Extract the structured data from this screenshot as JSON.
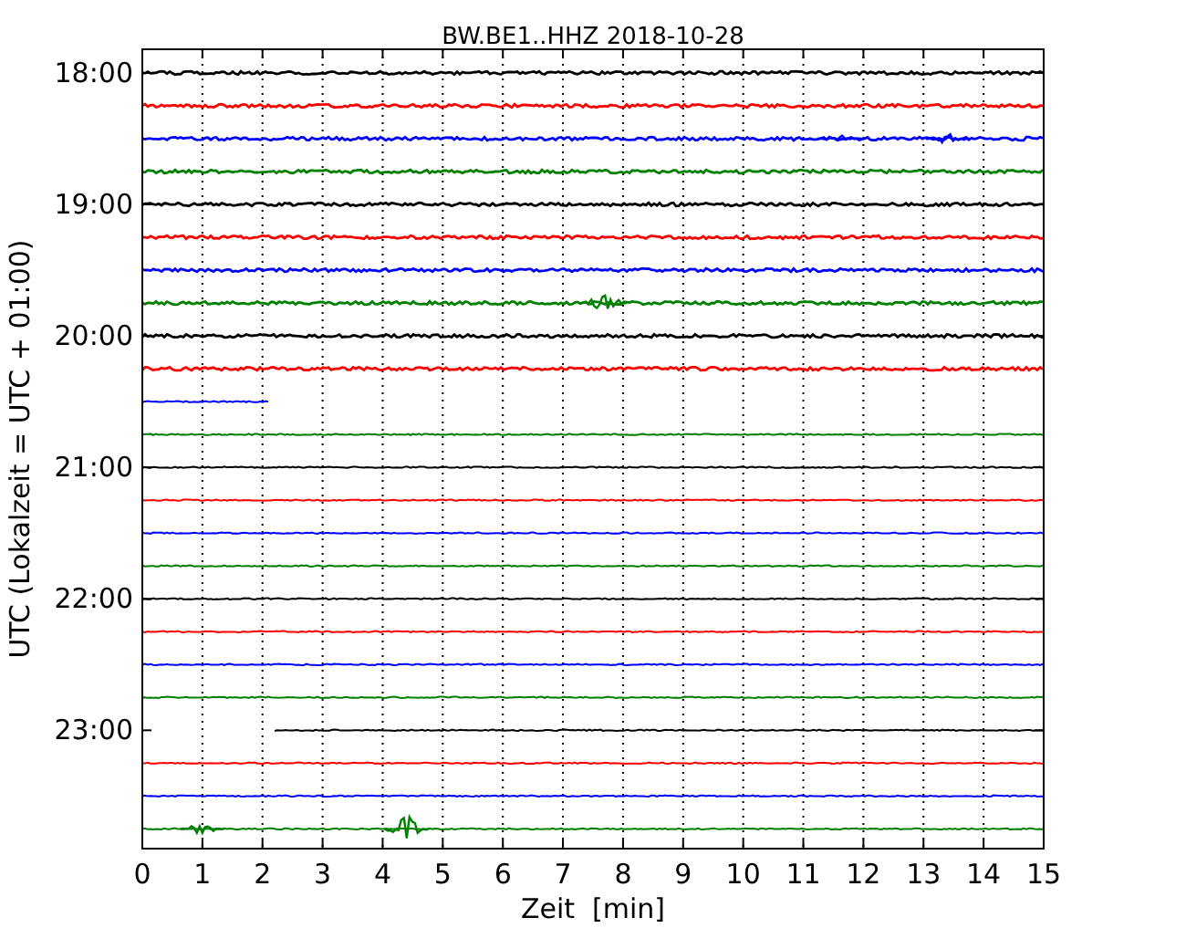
{
  "chart": {
    "chart_data": {
      "type": "line",
      "title": "BW.BE1..HHZ 2018-10-28",
      "xlabel": "Zeit  [min]",
      "ylabel": "UTC (Lokalzeit = UTC + 01:00)",
      "xlim": [
        0,
        15
      ],
      "ylim": [
        23.9,
        17.82
      ],
      "grid": "x",
      "xticks": [
        0,
        1,
        2,
        3,
        4,
        5,
        6,
        7,
        8,
        9,
        10,
        11,
        12,
        13,
        14,
        15
      ],
      "yticks": [
        {
          "value": 18,
          "label": "18:00"
        },
        {
          "value": 19,
          "label": "19:00"
        },
        {
          "value": 20,
          "label": "20:00"
        },
        {
          "value": 21,
          "label": "21:00"
        },
        {
          "value": 22,
          "label": "22:00"
        },
        {
          "value": 23,
          "label": "23:00"
        }
      ],
      "x": [
        0,
        1,
        2,
        2.1,
        2.2,
        3,
        4,
        5,
        6,
        7,
        8,
        9,
        10,
        11,
        12,
        13,
        14,
        15
      ],
      "series": [
        {
          "color": "#000000",
          "values": [
            18,
            18,
            18,
            18,
            18,
            18,
            18,
            18,
            18,
            18,
            18,
            18,
            18,
            18,
            18,
            18,
            18,
            18
          ]
        },
        {
          "color": "#ff0000",
          "values": [
            18.25,
            18.25,
            18.25,
            18.25,
            18.25,
            18.25,
            18.25,
            18.25,
            18.25,
            18.25,
            18.25,
            18.25,
            18.25,
            18.25,
            18.25,
            18.25,
            18.25,
            18.25
          ]
        },
        {
          "color": "#0000ff",
          "values": [
            18.5,
            18.5,
            18.5,
            18.5,
            18.5,
            18.5,
            18.5,
            18.5,
            18.5,
            18.5,
            18.5,
            18.5,
            18.5,
            18.5,
            18.5,
            18.5,
            18.5,
            18.5
          ]
        },
        {
          "color": "#008000",
          "values": [
            18.75,
            18.75,
            18.75,
            18.75,
            18.75,
            18.75,
            18.75,
            18.75,
            18.75,
            18.75,
            18.75,
            18.75,
            18.75,
            18.75,
            18.75,
            18.75,
            18.75,
            18.75
          ]
        },
        {
          "color": "#000000",
          "values": [
            19,
            19,
            19,
            19,
            19,
            19,
            19,
            19,
            19,
            19,
            19,
            19,
            19,
            19,
            19,
            19,
            19,
            19
          ]
        },
        {
          "color": "#ff0000",
          "values": [
            19.25,
            19.25,
            19.25,
            19.25,
            19.25,
            19.25,
            19.25,
            19.25,
            19.25,
            19.25,
            19.25,
            19.25,
            19.25,
            19.25,
            19.25,
            19.25,
            19.25,
            19.25
          ]
        },
        {
          "color": "#0000ff",
          "values": [
            19.5,
            19.5,
            19.5,
            19.5,
            19.5,
            19.5,
            19.5,
            19.5,
            19.5,
            19.5,
            19.5,
            19.5,
            19.5,
            19.5,
            19.5,
            19.5,
            19.5,
            19.5
          ]
        },
        {
          "color": "#008000",
          "values": [
            19.75,
            19.75,
            19.75,
            19.75,
            19.75,
            19.75,
            19.75,
            19.75,
            19.75,
            19.75,
            19.75,
            19.75,
            19.75,
            19.75,
            19.75,
            19.75,
            19.75,
            19.75
          ]
        },
        {
          "color": "#000000",
          "values": [
            20,
            20,
            20,
            20,
            20,
            20,
            20,
            20,
            20,
            20,
            20,
            20,
            20,
            20,
            20,
            20,
            20,
            20
          ]
        },
        {
          "color": "#ff0000",
          "values": [
            20.25,
            20.25,
            20.25,
            20.25,
            20.25,
            20.25,
            20.25,
            20.25,
            20.25,
            20.25,
            20.25,
            20.25,
            20.25,
            20.25,
            20.25,
            20.25,
            20.25,
            20.25
          ]
        },
        {
          "color": "#0000ff",
          "values": [
            20.5,
            20.5,
            20.5,
            20.5,
            null,
            null,
            null,
            null,
            null,
            null,
            null,
            null,
            null,
            null,
            null,
            null,
            null,
            null
          ]
        },
        {
          "color": "#008000",
          "values": [
            20.75,
            20.75,
            20.75,
            20.75,
            20.75,
            20.75,
            20.75,
            20.75,
            20.75,
            20.75,
            20.75,
            20.75,
            20.75,
            20.75,
            20.75,
            20.75,
            20.75,
            20.75
          ]
        },
        {
          "color": "#000000",
          "values": [
            21,
            21,
            21,
            21,
            21,
            21,
            21,
            21,
            21,
            21,
            21,
            21,
            21,
            21,
            21,
            21,
            21,
            21
          ]
        },
        {
          "color": "#ff0000",
          "values": [
            21.25,
            21.25,
            21.25,
            21.25,
            21.25,
            21.25,
            21.25,
            21.25,
            21.25,
            21.25,
            21.25,
            21.25,
            21.25,
            21.25,
            21.25,
            21.25,
            21.25,
            21.25
          ]
        },
        {
          "color": "#0000ff",
          "values": [
            21.5,
            21.5,
            21.5,
            21.5,
            21.5,
            21.5,
            21.5,
            21.5,
            21.5,
            21.5,
            21.5,
            21.5,
            21.5,
            21.5,
            21.5,
            21.5,
            21.5,
            21.5
          ]
        },
        {
          "color": "#008000",
          "values": [
            21.75,
            21.75,
            21.75,
            21.75,
            21.75,
            21.75,
            21.75,
            21.75,
            21.75,
            21.75,
            21.75,
            21.75,
            21.75,
            21.75,
            21.75,
            21.75,
            21.75,
            21.75
          ]
        },
        {
          "color": "#000000",
          "values": [
            22,
            22,
            22,
            22,
            22,
            22,
            22,
            22,
            22,
            22,
            22,
            22,
            22,
            22,
            22,
            22,
            22,
            22
          ]
        },
        {
          "color": "#ff0000",
          "values": [
            22.25,
            22.25,
            22.25,
            22.25,
            22.25,
            22.25,
            22.25,
            22.25,
            22.25,
            22.25,
            22.25,
            22.25,
            22.25,
            22.25,
            22.25,
            22.25,
            22.25,
            22.25
          ]
        },
        {
          "color": "#0000ff",
          "values": [
            22.5,
            22.5,
            22.5,
            22.5,
            22.5,
            22.5,
            22.5,
            22.5,
            22.5,
            22.5,
            22.5,
            22.5,
            22.5,
            22.5,
            22.5,
            22.5,
            22.5,
            22.5
          ]
        },
        {
          "color": "#008000",
          "values": [
            22.75,
            22.75,
            22.75,
            22.75,
            22.75,
            22.75,
            22.75,
            22.75,
            22.75,
            22.75,
            22.75,
            22.75,
            22.75,
            22.75,
            22.75,
            22.75,
            22.75,
            22.75
          ]
        },
        {
          "color": "#000000",
          "values": [
            null,
            null,
            null,
            null,
            23,
            23,
            23,
            23,
            23,
            23,
            23,
            23,
            23,
            23,
            23,
            23,
            23,
            23
          ]
        },
        {
          "color": "#ff0000",
          "values": [
            23.25,
            23.25,
            23.25,
            23.25,
            23.25,
            23.25,
            23.25,
            23.25,
            23.25,
            23.25,
            23.25,
            23.25,
            23.25,
            23.25,
            23.25,
            23.25,
            23.25,
            23.25
          ]
        },
        {
          "color": "#0000ff",
          "values": [
            23.5,
            23.5,
            23.5,
            23.5,
            23.5,
            23.5,
            23.5,
            23.5,
            23.5,
            23.5,
            23.5,
            23.5,
            23.5,
            23.5,
            23.5,
            23.5,
            23.5,
            23.5
          ]
        },
        {
          "color": "#008000",
          "values": [
            23.75,
            23.75,
            23.75,
            23.75,
            23.75,
            23.75,
            23.75,
            23.75,
            23.75,
            23.75,
            23.75,
            23.75,
            23.75,
            23.75,
            23.75,
            23.75,
            23.75,
            23.75
          ]
        }
      ]
    }
  }
}
